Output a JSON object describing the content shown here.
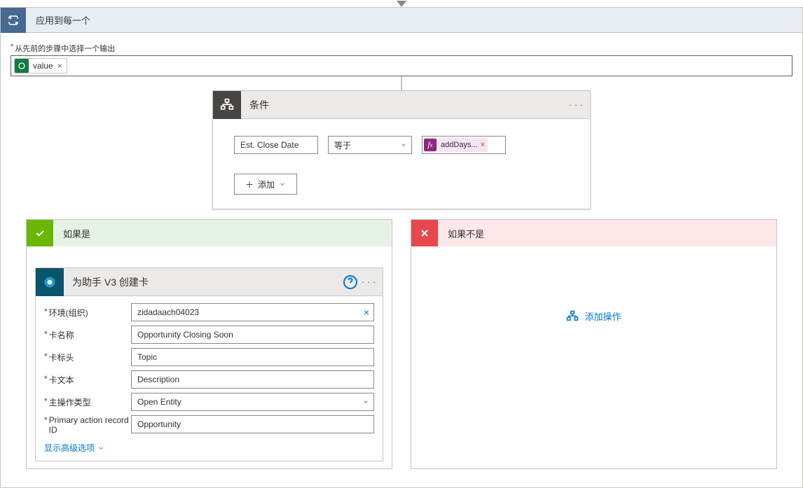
{
  "applyEach": {
    "title": "应用到每一个",
    "prevLabel": "从先前的步骤中选择一个输出",
    "tokenName": "value"
  },
  "condition": {
    "title": "条件",
    "left": "Est. Close Date",
    "op": "等于",
    "exprText": "addDays...",
    "addBtn": "添加"
  },
  "yesBranch": {
    "title": "如果是"
  },
  "noBranch": {
    "title": "如果不是",
    "addAction": "添加操作"
  },
  "actionCard": {
    "title": "为助手 V3 创建卡",
    "fields": {
      "envLabel": "环境(组织)",
      "envValue": "zidadaach04023",
      "nameLabel": "卡名称",
      "nameValue": "Opportunity Closing Soon",
      "headerLabel": "卡标头",
      "headerValue": "Topic",
      "textLabel": "卡文本",
      "textValue": "Description",
      "primaryActionTypeLabel": "主操作类型",
      "primaryActionTypeValue": "Open Entity",
      "primaryRecordLabel": "Primary action record ID",
      "primaryRecordValue": "Opportunity"
    },
    "advanced": "显示高级选项"
  }
}
